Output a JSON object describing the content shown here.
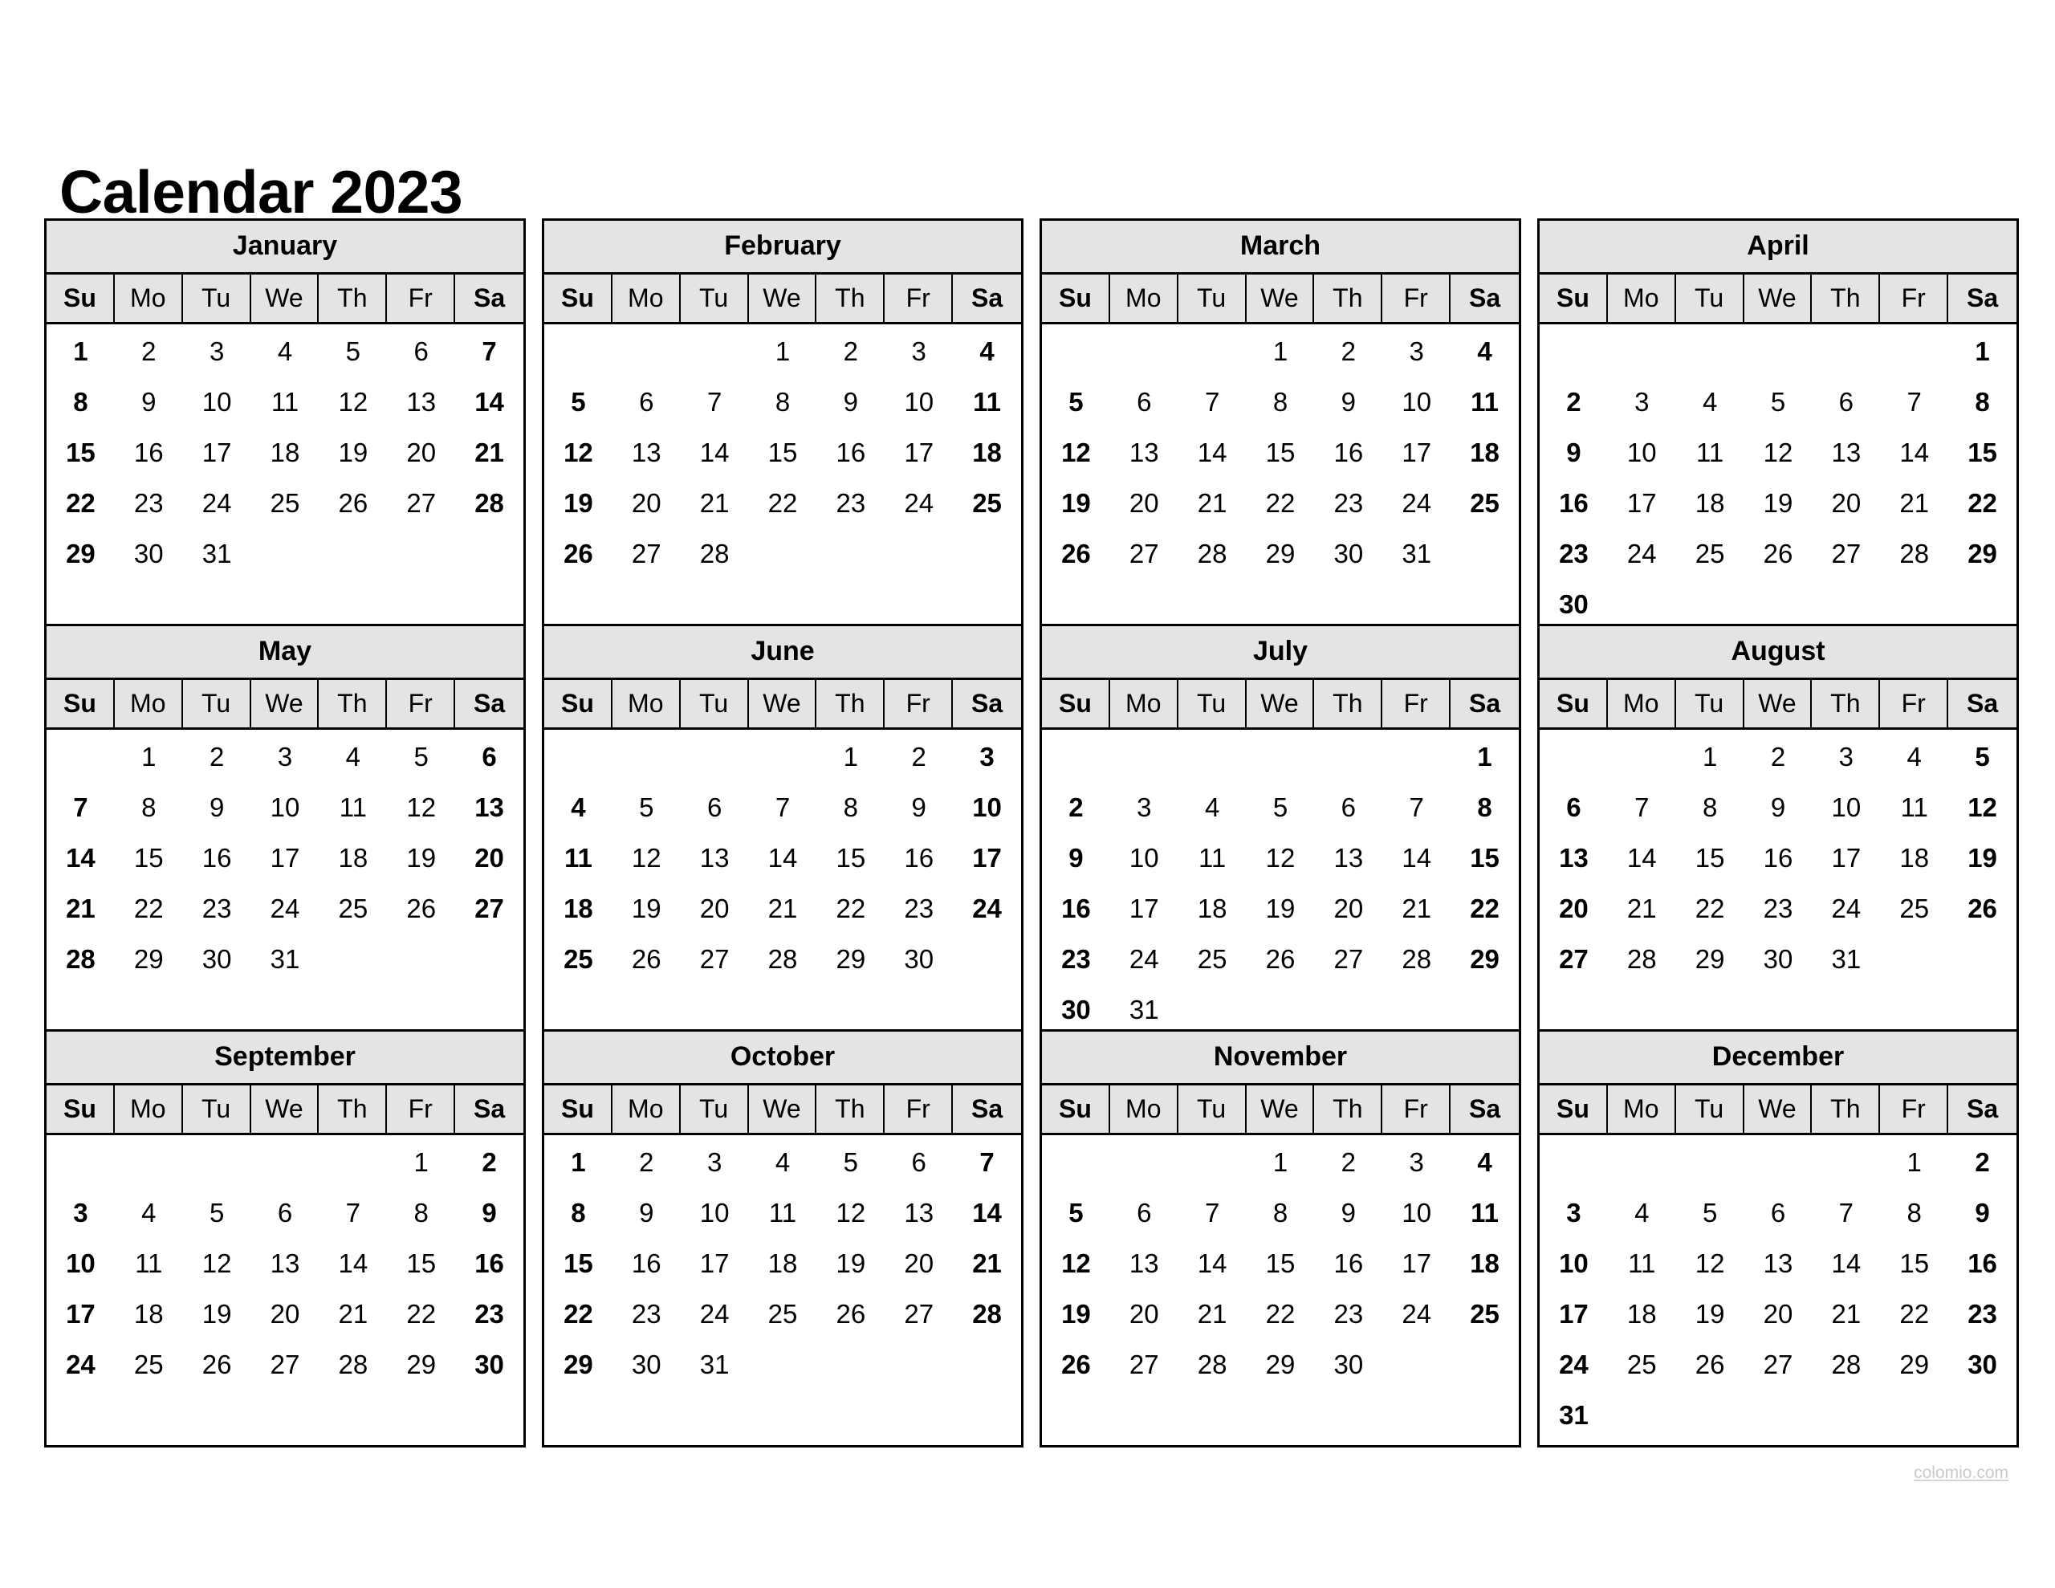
{
  "title": "Calendar 2023",
  "year": "2023",
  "watermark": "colomio.com",
  "colors": {
    "header_bg": "#e4e4e4",
    "border": "#000000",
    "text": "#000000",
    "watermark": "#c9c9c9",
    "page_bg": "#ffffff"
  },
  "weekdays": [
    "Su",
    "Mo",
    "Tu",
    "We",
    "Th",
    "Fr",
    "Sa"
  ],
  "weekend_columns": [
    0,
    6
  ],
  "months": [
    {
      "name": "January",
      "first_weekday_index": 0,
      "days_in_month": 31,
      "weeks": [
        [
          "1",
          "2",
          "3",
          "4",
          "5",
          "6",
          "7"
        ],
        [
          "8",
          "9",
          "10",
          "11",
          "12",
          "13",
          "14"
        ],
        [
          "15",
          "16",
          "17",
          "18",
          "19",
          "20",
          "21"
        ],
        [
          "22",
          "23",
          "24",
          "25",
          "26",
          "27",
          "28"
        ],
        [
          "29",
          "30",
          "31",
          "",
          "",
          "",
          ""
        ],
        [
          "",
          "",
          "",
          "",
          "",
          "",
          ""
        ]
      ]
    },
    {
      "name": "February",
      "first_weekday_index": 3,
      "days_in_month": 28,
      "weeks": [
        [
          "",
          "",
          "",
          "1",
          "2",
          "3",
          "4"
        ],
        [
          "5",
          "6",
          "7",
          "8",
          "9",
          "10",
          "11"
        ],
        [
          "12",
          "13",
          "14",
          "15",
          "16",
          "17",
          "18"
        ],
        [
          "19",
          "20",
          "21",
          "22",
          "23",
          "24",
          "25"
        ],
        [
          "26",
          "27",
          "28",
          "",
          "",
          "",
          ""
        ],
        [
          "",
          "",
          "",
          "",
          "",
          "",
          ""
        ]
      ]
    },
    {
      "name": "March",
      "first_weekday_index": 3,
      "days_in_month": 31,
      "weeks": [
        [
          "",
          "",
          "",
          "1",
          "2",
          "3",
          "4"
        ],
        [
          "5",
          "6",
          "7",
          "8",
          "9",
          "10",
          "11"
        ],
        [
          "12",
          "13",
          "14",
          "15",
          "16",
          "17",
          "18"
        ],
        [
          "19",
          "20",
          "21",
          "22",
          "23",
          "24",
          "25"
        ],
        [
          "26",
          "27",
          "28",
          "29",
          "30",
          "31",
          ""
        ],
        [
          "",
          "",
          "",
          "",
          "",
          "",
          ""
        ]
      ]
    },
    {
      "name": "April",
      "first_weekday_index": 6,
      "days_in_month": 30,
      "weeks": [
        [
          "",
          "",
          "",
          "",
          "",
          "",
          "1"
        ],
        [
          "2",
          "3",
          "4",
          "5",
          "6",
          "7",
          "8"
        ],
        [
          "9",
          "10",
          "11",
          "12",
          "13",
          "14",
          "15"
        ],
        [
          "16",
          "17",
          "18",
          "19",
          "20",
          "21",
          "22"
        ],
        [
          "23",
          "24",
          "25",
          "26",
          "27",
          "28",
          "29"
        ],
        [
          "30",
          "",
          "",
          "",
          "",
          "",
          ""
        ]
      ]
    },
    {
      "name": "May",
      "first_weekday_index": 1,
      "days_in_month": 31,
      "weeks": [
        [
          "",
          "1",
          "2",
          "3",
          "4",
          "5",
          "6"
        ],
        [
          "7",
          "8",
          "9",
          "10",
          "11",
          "12",
          "13"
        ],
        [
          "14",
          "15",
          "16",
          "17",
          "18",
          "19",
          "20"
        ],
        [
          "21",
          "22",
          "23",
          "24",
          "25",
          "26",
          "27"
        ],
        [
          "28",
          "29",
          "30",
          "31",
          "",
          "",
          ""
        ],
        [
          "",
          "",
          "",
          "",
          "",
          "",
          ""
        ]
      ]
    },
    {
      "name": "June",
      "first_weekday_index": 4,
      "days_in_month": 30,
      "weeks": [
        [
          "",
          "",
          "",
          "",
          "1",
          "2",
          "3"
        ],
        [
          "4",
          "5",
          "6",
          "7",
          "8",
          "9",
          "10"
        ],
        [
          "11",
          "12",
          "13",
          "14",
          "15",
          "16",
          "17"
        ],
        [
          "18",
          "19",
          "20",
          "21",
          "22",
          "23",
          "24"
        ],
        [
          "25",
          "26",
          "27",
          "28",
          "29",
          "30",
          ""
        ],
        [
          "",
          "",
          "",
          "",
          "",
          "",
          ""
        ]
      ]
    },
    {
      "name": "July",
      "first_weekday_index": 6,
      "days_in_month": 31,
      "weeks": [
        [
          "",
          "",
          "",
          "",
          "",
          "",
          "1"
        ],
        [
          "2",
          "3",
          "4",
          "5",
          "6",
          "7",
          "8"
        ],
        [
          "9",
          "10",
          "11",
          "12",
          "13",
          "14",
          "15"
        ],
        [
          "16",
          "17",
          "18",
          "19",
          "20",
          "21",
          "22"
        ],
        [
          "23",
          "24",
          "25",
          "26",
          "27",
          "28",
          "29"
        ],
        [
          "30",
          "31",
          "",
          "",
          "",
          "",
          ""
        ]
      ]
    },
    {
      "name": "August",
      "first_weekday_index": 2,
      "days_in_month": 31,
      "weeks": [
        [
          "",
          "",
          "1",
          "2",
          "3",
          "4",
          "5"
        ],
        [
          "6",
          "7",
          "8",
          "9",
          "10",
          "11",
          "12"
        ],
        [
          "13",
          "14",
          "15",
          "16",
          "17",
          "18",
          "19"
        ],
        [
          "20",
          "21",
          "22",
          "23",
          "24",
          "25",
          "26"
        ],
        [
          "27",
          "28",
          "29",
          "30",
          "31",
          "",
          ""
        ],
        [
          "",
          "",
          "",
          "",
          "",
          "",
          ""
        ]
      ]
    },
    {
      "name": "September",
      "first_weekday_index": 5,
      "days_in_month": 30,
      "weeks": [
        [
          "",
          "",
          "",
          "",
          "",
          "1",
          "2"
        ],
        [
          "3",
          "4",
          "5",
          "6",
          "7",
          "8",
          "9"
        ],
        [
          "10",
          "11",
          "12",
          "13",
          "14",
          "15",
          "16"
        ],
        [
          "17",
          "18",
          "19",
          "20",
          "21",
          "22",
          "23"
        ],
        [
          "24",
          "25",
          "26",
          "27",
          "28",
          "29",
          "30"
        ],
        [
          "",
          "",
          "",
          "",
          "",
          "",
          ""
        ]
      ]
    },
    {
      "name": "October",
      "first_weekday_index": 0,
      "days_in_month": 31,
      "weeks": [
        [
          "1",
          "2",
          "3",
          "4",
          "5",
          "6",
          "7"
        ],
        [
          "8",
          "9",
          "10",
          "11",
          "12",
          "13",
          "14"
        ],
        [
          "15",
          "16",
          "17",
          "18",
          "19",
          "20",
          "21"
        ],
        [
          "22",
          "23",
          "24",
          "25",
          "26",
          "27",
          "28"
        ],
        [
          "29",
          "30",
          "31",
          "",
          "",
          "",
          ""
        ],
        [
          "",
          "",
          "",
          "",
          "",
          "",
          ""
        ]
      ]
    },
    {
      "name": "November",
      "first_weekday_index": 3,
      "days_in_month": 30,
      "weeks": [
        [
          "",
          "",
          "",
          "1",
          "2",
          "3",
          "4"
        ],
        [
          "5",
          "6",
          "7",
          "8",
          "9",
          "10",
          "11"
        ],
        [
          "12",
          "13",
          "14",
          "15",
          "16",
          "17",
          "18"
        ],
        [
          "19",
          "20",
          "21",
          "22",
          "23",
          "24",
          "25"
        ],
        [
          "26",
          "27",
          "28",
          "29",
          "30",
          "",
          ""
        ],
        [
          "",
          "",
          "",
          "",
          "",
          "",
          ""
        ]
      ]
    },
    {
      "name": "December",
      "first_weekday_index": 5,
      "days_in_month": 31,
      "weeks": [
        [
          "",
          "",
          "",
          "",
          "",
          "1",
          "2"
        ],
        [
          "3",
          "4",
          "5",
          "6",
          "7",
          "8",
          "9"
        ],
        [
          "10",
          "11",
          "12",
          "13",
          "14",
          "15",
          "16"
        ],
        [
          "17",
          "18",
          "19",
          "20",
          "21",
          "22",
          "23"
        ],
        [
          "24",
          "25",
          "26",
          "27",
          "28",
          "29",
          "30"
        ],
        [
          "31",
          "",
          "",
          "",
          "",
          "",
          ""
        ]
      ]
    }
  ]
}
